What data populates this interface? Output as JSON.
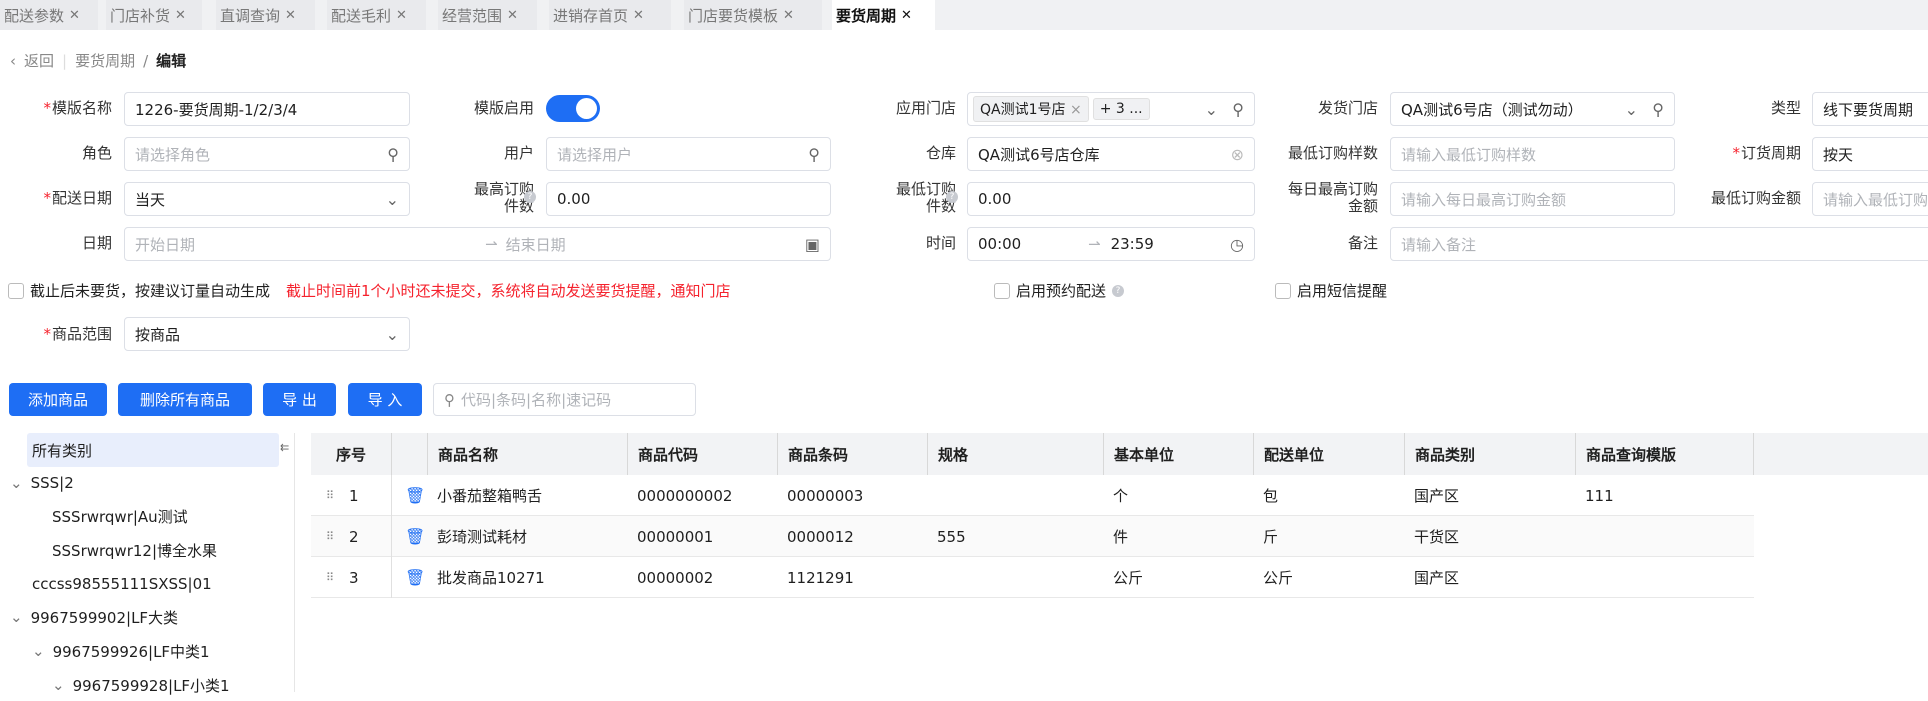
{
  "tabs": [
    {
      "label": "配送参数"
    },
    {
      "label": "门店补货"
    },
    {
      "label": "直调查询"
    },
    {
      "label": "配送毛利"
    },
    {
      "label": "经营范围"
    },
    {
      "label": "进销存首页"
    },
    {
      "label": "门店要货模板"
    },
    {
      "label": "要货周期",
      "active": true
    }
  ],
  "breadcrumb": {
    "back": "返回",
    "parent": "要货周期",
    "current": "编辑"
  },
  "form": {
    "template_name": {
      "label": "模版名称",
      "value": "1226-要货周期-1/2/3/4"
    },
    "template_enabled": {
      "label": "模版启用",
      "value": true
    },
    "apply_store": {
      "label": "应用门店",
      "tag": "QA测试1号店",
      "more": "+ 3 ..."
    },
    "ship_store": {
      "label": "发货门店",
      "value": "QA测试6号店（测试勿动）"
    },
    "type": {
      "label": "类型",
      "value": "线下要货周期"
    },
    "role": {
      "label": "角色",
      "placeholder": "请选择角色"
    },
    "user": {
      "label": "用户",
      "placeholder": "请选择用户"
    },
    "warehouse": {
      "label": "仓库",
      "value": "QA测试6号店仓库"
    },
    "min_order_samples": {
      "label": "最低订购样数",
      "placeholder": "请输入最低订购样数"
    },
    "order_cycle": {
      "label": "订货周期",
      "value": "按天"
    },
    "delivery_date": {
      "label": "配送日期",
      "value": "当天"
    },
    "max_order_qty": {
      "label_1": "最高订购",
      "label_2": "件数",
      "value": "0.00"
    },
    "min_order_qty": {
      "label_1": "最低订购",
      "label_2": "件数",
      "value": "0.00"
    },
    "daily_max_amount": {
      "label_1": "每日最高订购",
      "label_2": "金额",
      "placeholder": "请输入每日最高订购金额"
    },
    "min_order_amount": {
      "label": "最低订购金额",
      "placeholder": "请输入最低订购金额"
    },
    "date": {
      "label": "日期",
      "start_placeholder": "开始日期",
      "end_placeholder": "结束日期"
    },
    "time": {
      "label": "时间",
      "start": "00:00",
      "end": "23:59"
    },
    "remark": {
      "label": "备注",
      "placeholder": "请输入备注"
    },
    "auto_generate": {
      "label": "截止后未要货，按建议订量自动生成",
      "checked": false
    },
    "warning": "截止时间前1个小时还未提交，系统将自动发送要货提醒，通知门店",
    "reserve_delivery": {
      "label": "启用预约配送",
      "checked": false
    },
    "sms_reminder": {
      "label": "启用短信提醒",
      "checked": false
    },
    "product_scope": {
      "label": "商品范围",
      "value": "按商品"
    }
  },
  "toolbar": {
    "add": "添加商品",
    "delete_all": "删除所有商品",
    "export": "导 出",
    "import": "导 入",
    "search_placeholder": "代码|条码|名称|速记码"
  },
  "tree": [
    "所有类别",
    "SSS|2",
    "SSSrwrqwr|Au测试",
    "SSSrwrqwr12|博全水果",
    "cccss98555111SXSS|01",
    "9967599902|LF大类",
    "9967599926|LF中类1",
    "9967599928|LF小类1"
  ],
  "table": {
    "headers": [
      "序号",
      "商品名称",
      "商品代码",
      "商品条码",
      "规格",
      "基本单位",
      "配送单位",
      "商品类别",
      "商品查询模版"
    ],
    "rows": [
      [
        "1",
        "小番茄整箱鸭舌",
        "0000000002",
        "00000003",
        "",
        "个",
        "包",
        "国产区",
        "111"
      ],
      [
        "2",
        "彭琦测试耗材",
        "00000001",
        "0000012",
        "555",
        "件",
        "斤",
        "干货区",
        ""
      ],
      [
        "3",
        "批发商品10271",
        "00000002",
        "1121291",
        "",
        "公斤",
        "公斤",
        "国产区",
        ""
      ]
    ]
  }
}
